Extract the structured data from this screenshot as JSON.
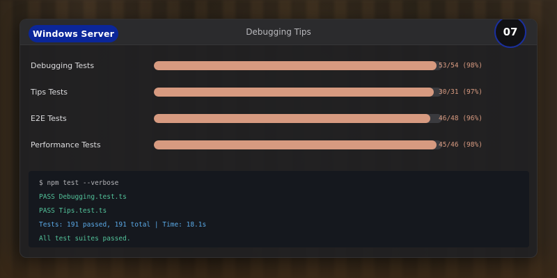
{
  "header": {
    "os_badge": "Windows Server",
    "title": "Debugging Tips",
    "step_number": "07"
  },
  "tests": [
    {
      "label": "Debugging Tests",
      "count": "53/54 (98%)",
      "progress": 0.98
    },
    {
      "label": "Tips Tests",
      "count": "30/31 (97%)",
      "progress": 0.97
    },
    {
      "label": "E2E Tests",
      "count": "46/48 (96%)",
      "progress": 0.96
    },
    {
      "label": "Performance Tests",
      "count": "45/46 (98%)",
      "progress": 0.98
    }
  ],
  "terminal": {
    "lines": [
      {
        "text": "$ npm test --verbose",
        "kind": "cmd"
      },
      {
        "text": "PASS Debugging.test.ts",
        "kind": "pass"
      },
      {
        "text": "PASS Tips.test.ts",
        "kind": "pass"
      },
      {
        "text": "Tests: 191 passed, 191 total | Time: 18.1s",
        "kind": "info"
      },
      {
        "text": "All test suites passed.",
        "kind": "pass"
      }
    ]
  },
  "colors": {
    "badge": "#0b2699",
    "progress_fill": "#d79a80",
    "pass": "#52c29a",
    "info": "#5aa9e6"
  }
}
